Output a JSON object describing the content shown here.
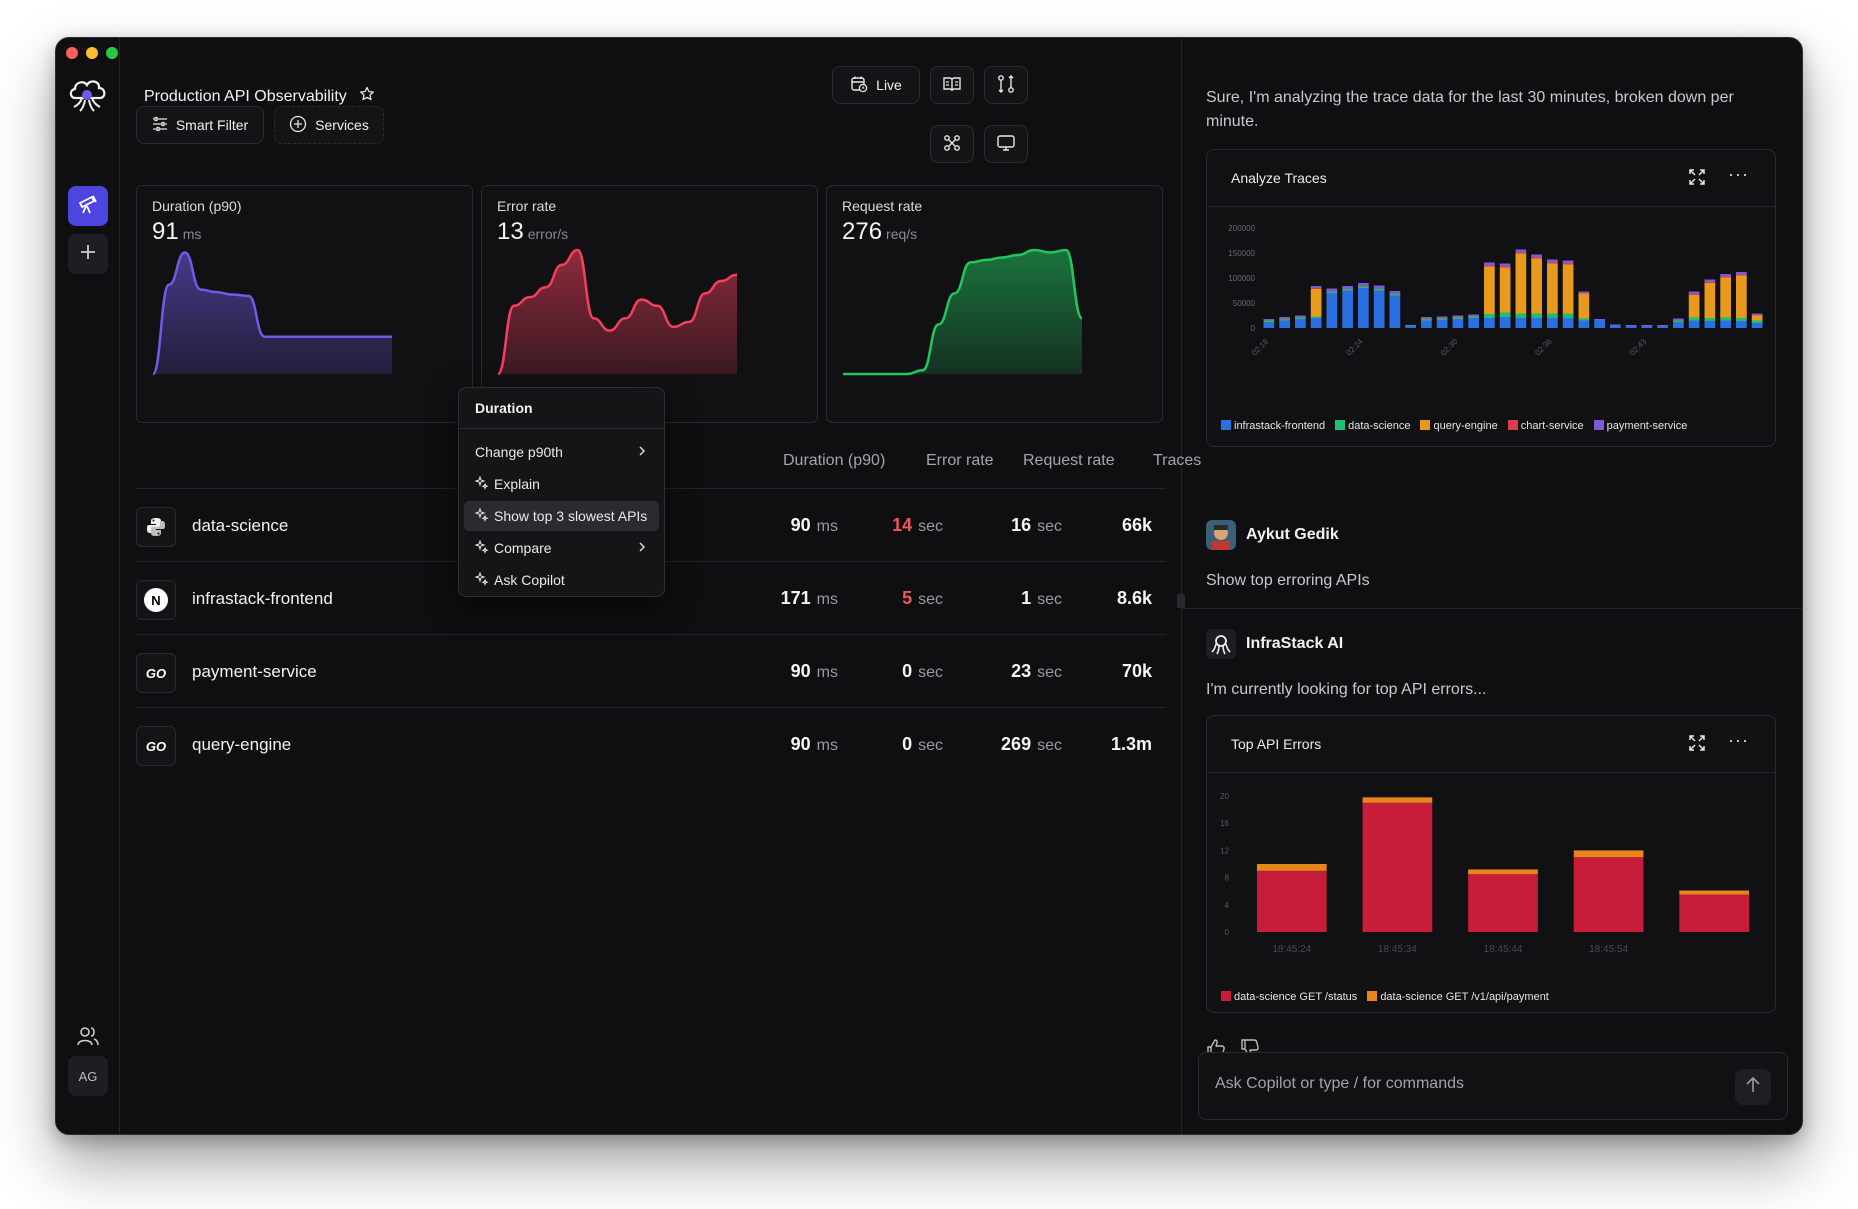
{
  "window": {
    "traffic_colors": [
      "#ff5f57",
      "#febc2e",
      "#28c840"
    ]
  },
  "sidebar": {
    "logo_icon": "cloud-octopus-icon",
    "items": [
      {
        "icon": "telescope-icon",
        "active": true
      },
      {
        "icon": "plus-icon",
        "active": false
      }
    ],
    "users_icon": "users-icon",
    "avatar_initials": "AG"
  },
  "header": {
    "title": "Production API Observability",
    "star_icon": "star-icon",
    "live_label": "Live",
    "smart_filter_label": "Smart Filter",
    "services_label": "Services"
  },
  "metrics": [
    {
      "label": "Duration (p90)",
      "value": "91",
      "unit": "ms",
      "color": "#6e5ce6",
      "points": [
        0,
        72,
        98,
        68,
        66,
        64,
        63,
        30,
        30,
        30,
        30,
        30,
        30,
        30,
        30,
        30
      ]
    },
    {
      "label": "Error rate",
      "value": "13",
      "unit": "error/s",
      "color": "#f43f5e",
      "points": [
        0,
        55,
        62,
        70,
        88,
        100,
        45,
        35,
        45,
        60,
        55,
        38,
        42,
        65,
        75,
        80
      ]
    },
    {
      "label": "Request rate",
      "value": "276",
      "unit": "req/s",
      "color": "#22c55e",
      "points": [
        0,
        0,
        0,
        0,
        0,
        3,
        40,
        65,
        90,
        92,
        94,
        96,
        100,
        98,
        100,
        45
      ]
    }
  ],
  "table": {
    "headers": [
      "Duration (p90)",
      "Error rate",
      "Request rate",
      "Traces"
    ],
    "rows": [
      {
        "icon": "python-icon",
        "icon_text": "",
        "name": "data-science",
        "duration": "90",
        "duration_unit": "ms",
        "error": "14",
        "error_unit": "sec",
        "error_color": "#f0555a",
        "request": "16",
        "request_unit": "sec",
        "traces": "66k"
      },
      {
        "icon": "nextjs-icon",
        "icon_text": "N",
        "name": "infrastack-frontend",
        "duration": "171",
        "duration_unit": "ms",
        "error": "5",
        "error_unit": "sec",
        "error_color": "#f0555a",
        "request": "1",
        "request_unit": "sec",
        "traces": "8.6k"
      },
      {
        "icon": "go-icon",
        "icon_text": "GO",
        "name": "payment-service",
        "duration": "90",
        "duration_unit": "ms",
        "error": "0",
        "error_unit": "sec",
        "error_color": "#f5f5f5",
        "request": "23",
        "request_unit": "sec",
        "traces": "70k"
      },
      {
        "icon": "go-icon",
        "icon_text": "GO",
        "name": "query-engine",
        "duration": "90",
        "duration_unit": "ms",
        "error": "0",
        "error_unit": "sec",
        "error_color": "#f5f5f5",
        "request": "269",
        "request_unit": "sec",
        "traces": "1.3m"
      }
    ]
  },
  "context_menu": {
    "title": "Duration",
    "items": [
      {
        "label": "Change p90th",
        "has_submenu": true,
        "ai": false,
        "highlighted": false
      },
      {
        "label": "Explain",
        "has_submenu": false,
        "ai": true,
        "highlighted": false
      },
      {
        "label": "Show top 3 slowest APIs",
        "has_submenu": false,
        "ai": true,
        "highlighted": true
      },
      {
        "label": "Compare",
        "has_submenu": true,
        "ai": true,
        "highlighted": false
      },
      {
        "label": "Ask Copilot",
        "has_submenu": false,
        "ai": true,
        "highlighted": false
      }
    ]
  },
  "copilot": {
    "intro": "Sure, I'm analyzing the trace data for the last 30 minutes, broken down per minute.",
    "user_name": "Aykut Gedik",
    "user_message": "Show top erroring APIs",
    "ai_name": "InfraStack AI",
    "ai_message": "I'm currently looking for top API errors...",
    "input_placeholder": "Ask Copilot or type / for commands"
  },
  "chart_data": [
    {
      "type": "bar",
      "title": "Analyze Traces",
      "stacked": true,
      "ylim": [
        0,
        200000
      ],
      "yticks": [
        0,
        50000,
        100000,
        150000,
        200000
      ],
      "ytick_labels": [
        "0",
        "50000",
        "100000",
        "150000",
        "200000"
      ],
      "xtick_labels": [
        "02:18",
        "02:24",
        "02:30",
        "02:36",
        "02:43"
      ],
      "xtick_positions": [
        0,
        6,
        12,
        18,
        24
      ],
      "legend_position": "bottom",
      "series": [
        {
          "name": "infrastack-frontend",
          "color": "#2b6fe0",
          "values": [
            12000,
            15000,
            18000,
            20000,
            70000,
            75000,
            80000,
            75000,
            65000,
            4000,
            15000,
            16000,
            18000,
            20000,
            20000,
            22000,
            20000,
            20000,
            20000,
            20000,
            15000,
            16000,
            5000,
            4000,
            4000,
            4000,
            12000,
            15000,
            14000,
            15000,
            14000,
            10000
          ]
        },
        {
          "name": "data-science",
          "color": "#1fbf73",
          "values": [
            3000,
            3000,
            3000,
            3000,
            3000,
            3000,
            3000,
            3000,
            3000,
            1000,
            3000,
            3000,
            3000,
            3000,
            8000,
            9000,
            9000,
            9000,
            9000,
            9000,
            4000,
            0,
            0,
            0,
            0,
            0,
            3000,
            6000,
            6000,
            6000,
            6000,
            5000
          ]
        },
        {
          "name": "query-engine",
          "color": "#e79a1e",
          "values": [
            0,
            0,
            0,
            55000,
            0,
            0,
            0,
            0,
            0,
            0,
            0,
            0,
            0,
            0,
            95000,
            90000,
            120000,
            110000,
            100000,
            98000,
            50000,
            0,
            0,
            0,
            0,
            0,
            0,
            45000,
            70000,
            80000,
            85000,
            10000
          ]
        },
        {
          "name": "chart-service",
          "color": "#e03a4e",
          "values": [
            1000,
            1000,
            1000,
            2000,
            1000,
            1000,
            1000,
            1000,
            1000,
            0,
            1000,
            1000,
            1000,
            1000,
            2000,
            2000,
            2000,
            2000,
            2000,
            2000,
            1000,
            0,
            0,
            0,
            0,
            0,
            1000,
            2000,
            2000,
            2000,
            2000,
            1000
          ]
        },
        {
          "name": "payment-service",
          "color": "#7b5cd6",
          "values": [
            2000,
            3000,
            3000,
            4000,
            5000,
            5000,
            6000,
            6000,
            5000,
            1000,
            3000,
            3000,
            3000,
            3000,
            6000,
            6000,
            6000,
            6000,
            6000,
            6000,
            3000,
            2000,
            2000,
            2000,
            2000,
            2000,
            3000,
            5000,
            5000,
            5000,
            5000,
            3000
          ]
        }
      ]
    },
    {
      "type": "bar",
      "title": "Top API Errors",
      "stacked": true,
      "categories": [
        "18:45:24",
        "18:45:34",
        "18:45:44",
        "18:45:54",
        ""
      ],
      "ylim": [
        0,
        20
      ],
      "yticks": [
        0,
        4,
        8,
        12,
        16,
        20
      ],
      "legend_position": "bottom",
      "series": [
        {
          "name": "data-science GET /status",
          "color": "#c81d3a",
          "values": [
            9,
            19,
            8.5,
            11,
            5.5
          ]
        },
        {
          "name": "data-science GET /v1/api/payment",
          "color": "#e8861e",
          "values": [
            1,
            0.8,
            0.7,
            1,
            0.6
          ]
        }
      ]
    }
  ]
}
